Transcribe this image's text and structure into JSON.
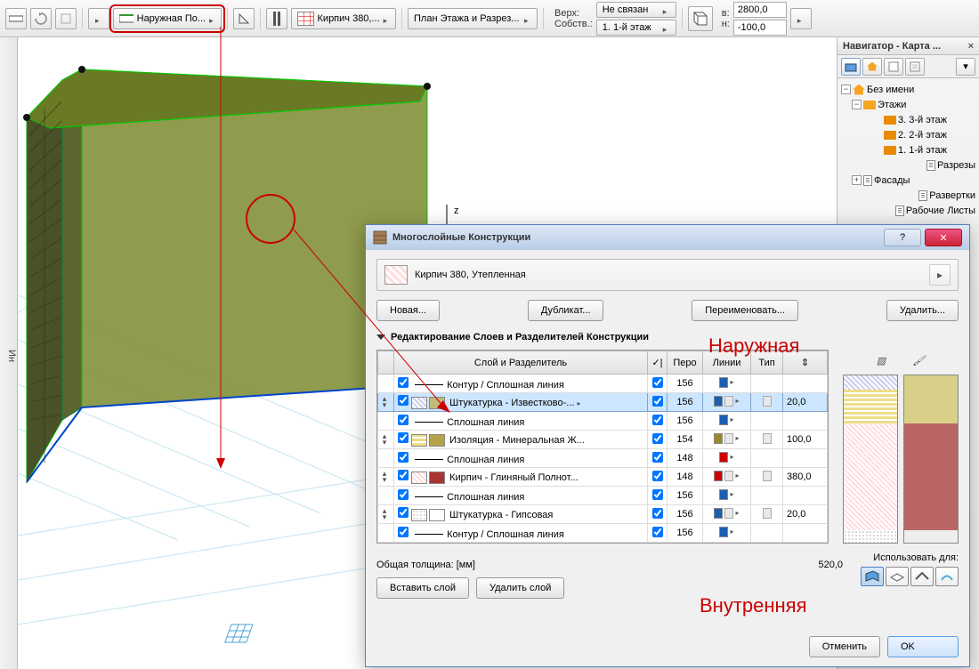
{
  "toolbar": {
    "geometry_dropdown": "Наружная По...",
    "material_dropdown": "Кирпич 380,...",
    "plan_dropdown": "План Этажа и Разрез...",
    "top_label": "Верх:",
    "own_label": "Собств.:",
    "top_value": "Не связан",
    "own_value": "1. 1-й этаж",
    "w_label": "в:",
    "h_label": "н:",
    "w_value": "2800,0",
    "h_value": "-100,0"
  },
  "sidebar_label": "Ин",
  "navigator": {
    "title": "Навигатор - Карта ...",
    "root": "Без имени",
    "floors_group": "Этажи",
    "floors": [
      "3. 3-й этаж",
      "2. 2-й этаж",
      "1. 1-й этаж"
    ],
    "sections": "Разрезы",
    "elevations": "Фасады",
    "interior": "Развертки",
    "worksheets": "Рабочие Листы"
  },
  "viewport": {
    "axis_z": "z"
  },
  "dialog": {
    "title": "Многослойные Конструкции",
    "composite_name": "Кирпич 380, Утепленная",
    "btn_new": "Новая...",
    "btn_duplicate": "Дубликат...",
    "btn_rename": "Переименовать...",
    "btn_delete": "Удалить...",
    "section_title": "Редактирование Слоев и Разделителей Конструкции",
    "th_layer": "Слой и Разделитель",
    "th_pen_toggle": "✓",
    "th_pen": "Перо",
    "th_line": "Линии",
    "th_type": "Тип",
    "th_thickness": "⇕",
    "rows": [
      {
        "name": "Контур / Сплошная линия",
        "pen": "156",
        "thickness": "",
        "is_sep": true
      },
      {
        "name": "Штукатурка - Известково-...",
        "pen": "156",
        "thickness": "20,0",
        "is_sep": false,
        "selected": true
      },
      {
        "name": "Сплошная линия",
        "pen": "156",
        "thickness": "",
        "is_sep": true
      },
      {
        "name": "Изоляция - Минеральная Ж...",
        "pen": "154",
        "thickness": "100,0",
        "is_sep": false
      },
      {
        "name": "Сплошная линия",
        "pen": "148",
        "thickness": "",
        "is_sep": true
      },
      {
        "name": "Кирпич - Глиняный Полнот...",
        "pen": "148",
        "thickness": "380,0",
        "is_sep": false
      },
      {
        "name": "Сплошная линия",
        "pen": "156",
        "thickness": "",
        "is_sep": true
      },
      {
        "name": "Штукатурка - Гипсовая",
        "pen": "156",
        "thickness": "20,0",
        "is_sep": false
      },
      {
        "name": "Контур / Сплошная линия",
        "pen": "156",
        "thickness": "",
        "is_sep": true
      }
    ],
    "total_label": "Общая толщина: [мм]",
    "total_value": "520,0",
    "btn_insert": "Вставить слой",
    "btn_remove": "Удалить слой",
    "use_for_label": "Использовать для:",
    "btn_cancel": "Отменить",
    "btn_ok": "OK"
  },
  "annotations": {
    "outer": "Наружная",
    "inner": "Внутренняя"
  }
}
